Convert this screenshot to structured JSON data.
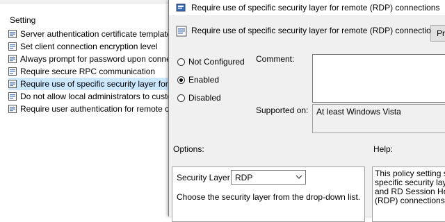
{
  "list": {
    "header": "Setting",
    "items": [
      {
        "label": "Server authentication certificate template",
        "selected": false
      },
      {
        "label": "Set client connection encryption level",
        "selected": false
      },
      {
        "label": "Always prompt for password upon connect",
        "selected": false
      },
      {
        "label": "Require secure RPC communication",
        "selected": false
      },
      {
        "label": "Require use of specific security layer for rem",
        "selected": true
      },
      {
        "label": "Do not allow local administrators to custom",
        "selected": false
      },
      {
        "label": "Require user authentication for remote con",
        "selected": false
      }
    ]
  },
  "dialog": {
    "title": "Require use of specific security layer for remote (RDP) connections",
    "header": "Require use of specific security layer for remote (RDP) connections",
    "previous_button": "Pre",
    "radios": {
      "not_configured": "Not Configured",
      "enabled": "Enabled",
      "disabled": "Disabled",
      "selected": "enabled"
    },
    "comment_label": "Comment:",
    "comment_value": "",
    "supported_label": "Supported on:",
    "supported_value": "At least Windows Vista",
    "options_label": "Options:",
    "help_label": "Help:",
    "security_layer_label": "Security Layer",
    "security_layer_value": "RDP",
    "options_hint": "Choose the security layer from the drop-down list.",
    "help_lines": [
      "This policy setting sp",
      "specific security laye",
      "and RD Session Host",
      "(RDP) connections."
    ]
  },
  "colors": {
    "selection": "#cce8ff",
    "dialog_bg": "#f0f0f0"
  },
  "icons": {
    "policy": "policy-setting-icon",
    "title": "gpo-app-icon",
    "header": "policy-setting-icon",
    "dropdown": "chevron-down-icon"
  }
}
